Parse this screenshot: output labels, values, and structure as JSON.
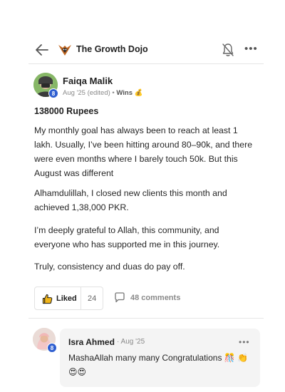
{
  "header": {
    "group_name": "The Growth Dojo",
    "back_icon": "arrow-left-icon",
    "bell_icon": "bell-off-icon",
    "more_label": "•••"
  },
  "post": {
    "author": "Faiqa Malik",
    "level": "8",
    "meta_time": "Aug '25 (edited)",
    "meta_sep": " • ",
    "category": "Wins",
    "category_emoji": "💰",
    "title": "138000 Rupees",
    "paragraphs": [
      "My monthly goal has always been to reach at least 1 lakh. Usually, I’ve been hitting around 80–90k, and there were even months where I barely touch 50k. But this August was different",
      "Alhamdulillah, I closed new clients this month and achieved 1,38,000 PKR.",
      "I’m deeply grateful to Allah, this community, and everyone who has supported me in this journey.",
      "Truly, consistency and duas do pay off."
    ],
    "like_label": "Liked",
    "like_count": "24",
    "comments_label": "48 comments"
  },
  "comment": {
    "author": "Isra Ahmed",
    "level": "8",
    "time": "· Aug '25",
    "more_label": "•••",
    "text": "MashaAllah many many Congratulations 🎊 👏 😍😍"
  },
  "colors": {
    "badge": "#2f5fd0",
    "bubble": "#f4f4f4",
    "divider": "#e6e6e6"
  }
}
